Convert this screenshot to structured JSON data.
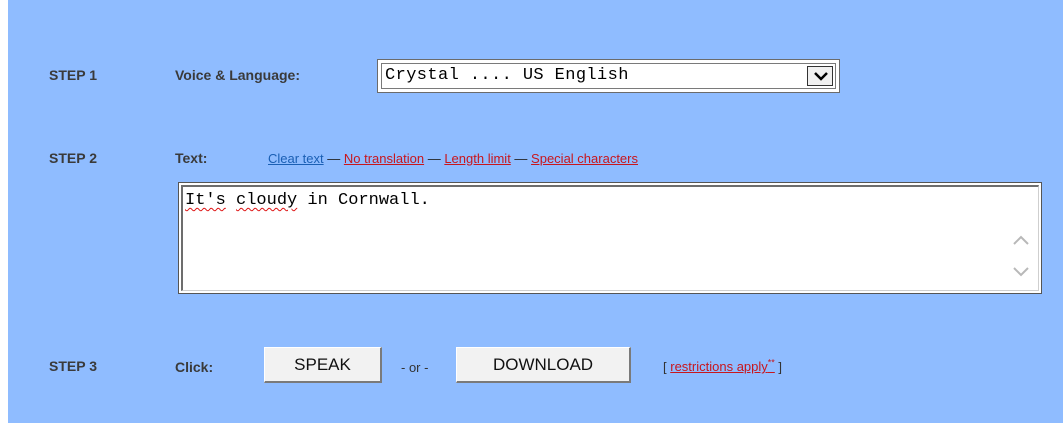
{
  "step1": {
    "step_label": "STEP 1",
    "field_label": "Voice & Language:",
    "selected_voice": "Crystal .... US English"
  },
  "step2": {
    "step_label": "STEP 2",
    "field_label": "Text:",
    "links": {
      "clear_text": "Clear text",
      "sep1": " — ",
      "no_translation": "No translation",
      "sep2": " — ",
      "length_limit": "Length limit",
      "sep3": " — ",
      "special_characters": "Special characters"
    },
    "text_value": {
      "w1": "It's",
      "sp1": " ",
      "w2": "cloudy",
      "rest": " in Cornwall."
    }
  },
  "step3": {
    "step_label": "STEP 3",
    "field_label": "Click:",
    "speak_button": "SPEAK",
    "or_text": "- or -",
    "download_button": "DOWNLOAD",
    "restrictions_open": "[ ",
    "restrictions_link": "restrictions apply",
    "restrictions_mark": "**",
    "restrictions_close": " ]"
  },
  "colors": {
    "panel_bg": "#8fbcff",
    "link_blue": "#1a5fb4",
    "link_red": "#c8161d"
  },
  "icons": [
    "chevron-down-icon",
    "chevron-up-icon"
  ]
}
